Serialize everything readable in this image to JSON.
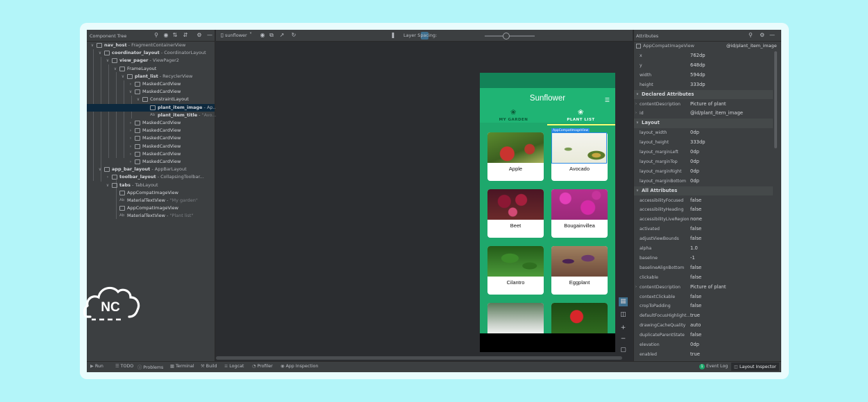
{
  "left_panel": {
    "title": "Component Tree",
    "tree": [
      {
        "name": "nav_host",
        "type": "FragmentContainerView"
      },
      {
        "name": "coordinator_layout",
        "type": "CoordinatorLayout"
      },
      {
        "name": "view_pager",
        "type": "ViewPager2"
      },
      {
        "name": "FrameLayout",
        "type": ""
      },
      {
        "name": "plant_list",
        "type": "RecyclerView"
      },
      {
        "name": "MaskedCardView",
        "type": ""
      },
      {
        "name": "MaskedCardView",
        "type": ""
      },
      {
        "name": "ConstraintLayout",
        "type": ""
      },
      {
        "name": "plant_item_image",
        "type": "Ap..."
      },
      {
        "name": "plant_item_title",
        "type": "\"Avo..."
      },
      {
        "name": "MaskedCardView",
        "type": ""
      },
      {
        "name": "MaskedCardView",
        "type": ""
      },
      {
        "name": "MaskedCardView",
        "type": ""
      },
      {
        "name": "MaskedCardView",
        "type": ""
      },
      {
        "name": "MaskedCardView",
        "type": ""
      },
      {
        "name": "MaskedCardView",
        "type": ""
      },
      {
        "name": "app_bar_layout",
        "type": "AppBarLayout"
      },
      {
        "name": "toolbar_layout",
        "type": "CollapsingToolbar..."
      },
      {
        "name": "tabs",
        "type": "TabLayout"
      },
      {
        "name": "AppCompatImageView",
        "type": ""
      },
      {
        "name": "MaterialTextView",
        "type": "\"My garden\""
      },
      {
        "name": "AppCompatImageView",
        "type": ""
      },
      {
        "name": "MaterialTextView",
        "type": "\"Plant list\""
      }
    ]
  },
  "toolbar": {
    "device": "sunflower",
    "layer_spacing_label": "Layer Spacing:",
    "layer_spacing_level": 0.35
  },
  "app": {
    "title": "Sunflower",
    "tabs": [
      "MY GARDEN",
      "PLANT LIST"
    ],
    "selection_label": "AppCompatImageView",
    "plants": [
      "Apple",
      "Avocado",
      "Beet",
      "Bougainvillea",
      "Cilantro",
      "Eggplant",
      "",
      ""
    ]
  },
  "right_panel": {
    "title": "Attributes",
    "view_type": "AppCompatImageView",
    "view_id": "@id/plant_item_image",
    "dimensions": [
      {
        "k": "x",
        "v": "762dp"
      },
      {
        "k": "y",
        "v": "648dp"
      },
      {
        "k": "width",
        "v": "594dp"
      },
      {
        "k": "height",
        "v": "333dp"
      }
    ],
    "sections": [
      "Declared Attributes",
      "Layout",
      "All Attributes"
    ],
    "declared": [
      {
        "k": "contentDescription",
        "v": "Picture of plant"
      },
      {
        "k": "id",
        "v": "@id/plant_item_image"
      }
    ],
    "layout": [
      {
        "k": "layout_width",
        "v": "0dp"
      },
      {
        "k": "layout_height",
        "v": "333dp"
      },
      {
        "k": "layout_marginLeft",
        "v": "0dp"
      },
      {
        "k": "layout_marginTop",
        "v": "0dp"
      },
      {
        "k": "layout_marginRight",
        "v": "0dp"
      },
      {
        "k": "layout_marginBottom",
        "v": "0dp"
      }
    ],
    "all": [
      {
        "k": "accessibilityFocused",
        "v": "false"
      },
      {
        "k": "accessibilityHeading",
        "v": "false"
      },
      {
        "k": "accessibilityLiveRegion",
        "v": "none"
      },
      {
        "k": "activated",
        "v": "false"
      },
      {
        "k": "adjustViewBounds",
        "v": "false"
      },
      {
        "k": "alpha",
        "v": "1.0"
      },
      {
        "k": "baseline",
        "v": "-1"
      },
      {
        "k": "baselineAlignBottom",
        "v": "false"
      },
      {
        "k": "clickable",
        "v": "false"
      },
      {
        "k": "contentDescription",
        "v": "Picture of plant"
      },
      {
        "k": "contextClickable",
        "v": "false"
      },
      {
        "k": "cropToPadding",
        "v": "false"
      },
      {
        "k": "defaultFocusHighlight...",
        "v": "true"
      },
      {
        "k": "drawingCacheQuality",
        "v": "auto"
      },
      {
        "k": "duplicateParentState",
        "v": "false"
      },
      {
        "k": "elevation",
        "v": "0dp"
      },
      {
        "k": "enabled",
        "v": "true"
      }
    ]
  },
  "bottom_bar": {
    "left": [
      "Run",
      "TODO",
      "Problems",
      "Terminal",
      "Build",
      "Logcat",
      "Profiler",
      "App Inspection"
    ],
    "right": [
      "Event Log",
      "Layout Inspector"
    ],
    "event_count": "1"
  },
  "logo": {
    "text": "NC"
  }
}
